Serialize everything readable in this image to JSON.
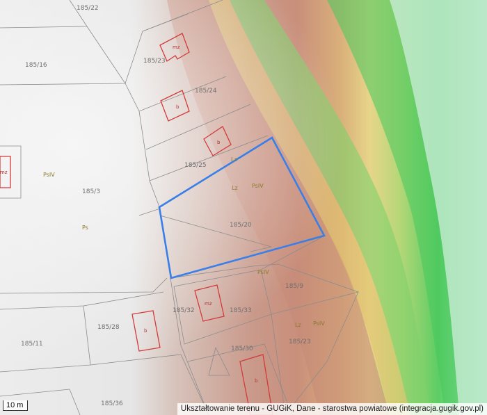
{
  "map": {
    "scale_label": "10 m",
    "attribution": "Ukształtowanie terenu - GUGiK, Dane - starostwa powiatowe (integracja.gugik.gov.pl)",
    "colors": {
      "selected_parcel": "#3a7fe8",
      "parcel_line": "#8c8c8c",
      "building_outline": "#d23a3a",
      "terrain_low": "#e9e9e9",
      "terrain_mid": "#c49a86",
      "terrain_high": "#6fd46a"
    },
    "parcels": [
      {
        "id": "p1",
        "label": "185/16"
      },
      {
        "id": "p2",
        "label": "185/22"
      },
      {
        "id": "p3",
        "label": "185/23"
      },
      {
        "id": "p4",
        "label": "185/24"
      },
      {
        "id": "p5",
        "label": "185/25"
      },
      {
        "id": "p6",
        "label": "185/3"
      },
      {
        "id": "p7",
        "label": "185/20"
      },
      {
        "id": "p8",
        "label": "185/9"
      },
      {
        "id": "p9",
        "label": "185/32"
      },
      {
        "id": "p10",
        "label": "185/33"
      },
      {
        "id": "p11",
        "label": "185/28"
      },
      {
        "id": "p12",
        "label": "185/11"
      },
      {
        "id": "p13",
        "label": "185/30"
      },
      {
        "id": "p14",
        "label": "185/23"
      },
      {
        "id": "p15",
        "label": "185/36"
      }
    ],
    "land_use_labels": [
      "PsIV",
      "PsIV",
      "Lz",
      "Lz",
      "PsIV",
      "PsIV",
      "Ps",
      "Lz"
    ],
    "building_labels": [
      "mz",
      "b",
      "b",
      "mz",
      "b",
      "b",
      "mz"
    ]
  }
}
